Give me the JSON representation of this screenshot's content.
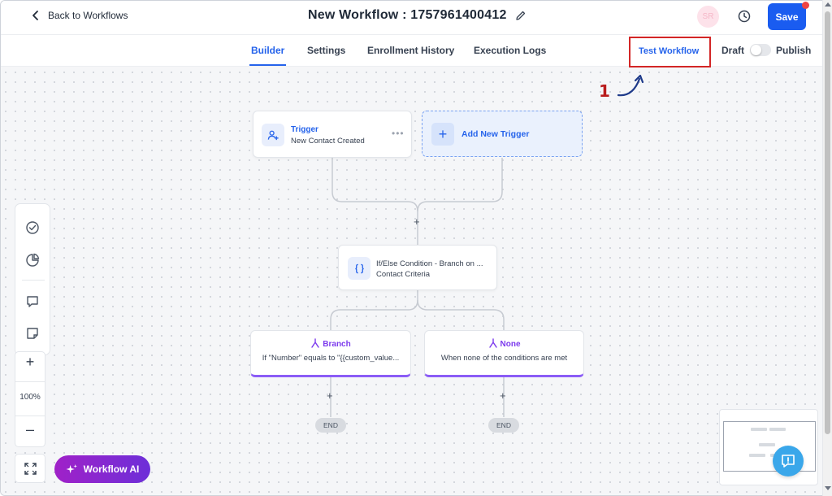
{
  "header": {
    "back_label": "Back to Workflows",
    "title": "New Workflow : 1757961400412",
    "avatar_initials": "SR",
    "save_label": "Save"
  },
  "tabs": [
    {
      "label": "Builder",
      "active": true
    },
    {
      "label": "Settings",
      "active": false
    },
    {
      "label": "Enrollment History",
      "active": false
    },
    {
      "label": "Execution Logs",
      "active": false
    }
  ],
  "actions": {
    "test_label": "Test Workflow",
    "draft_label": "Draft",
    "publish_label": "Publish",
    "publish_on": false
  },
  "annotation": {
    "step": "1"
  },
  "nodes": {
    "trigger": {
      "title": "Trigger",
      "subtitle": "New Contact Created",
      "more": "•••",
      "icon": "person-plus-icon"
    },
    "add_trigger": {
      "label": "Add New Trigger",
      "icon": "plus-icon"
    },
    "condition": {
      "title": "If/Else Condition - Branch on ...",
      "subtitle": "Contact Criteria",
      "icon": "braces-icon"
    },
    "branch": {
      "title": "Branch",
      "subtitle": "If \"Number\" equals to \"{{custom_value...",
      "icon": "split-icon"
    },
    "none": {
      "title": "None",
      "subtitle": "When none of the conditions are met",
      "icon": "split-icon"
    }
  },
  "flow": {
    "plus": "+",
    "end_label": "END"
  },
  "zoom": {
    "in": "+",
    "level": "100%",
    "out": "–"
  },
  "ai_button": {
    "label": "Workflow AI"
  },
  "colors": {
    "primary": "#1a5cf0",
    "accent_blue": "#2563eb",
    "branch_purple": "#8b5cf6",
    "annotation_red": "#d32626",
    "ai_gradient_start": "#a021c8",
    "ai_gradient_end": "#6d2fd8",
    "help_blue": "#3aa7ea"
  }
}
